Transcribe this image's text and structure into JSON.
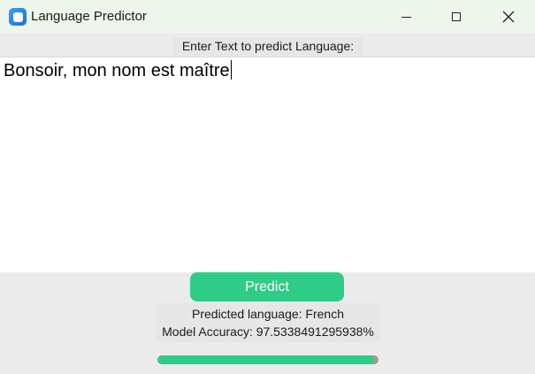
{
  "window": {
    "title": "Language Predictor",
    "icon": "app-icon",
    "controls": [
      "minimize-icon",
      "maximize-icon",
      "close-icon"
    ]
  },
  "input": {
    "label": "Enter Text to predict Language:",
    "value": "Bonsoir, mon nom est maître"
  },
  "actions": {
    "predict_label": "Predict"
  },
  "result": {
    "predicted_language": "Predicted language: French",
    "model_accuracy": "Model Accuracy: 97.5338491295938%"
  },
  "progress": {
    "fraction": 0.98
  },
  "colors": {
    "accent": "#2ecc87",
    "track": "#9a9a9a",
    "titlebar": "#eef5eb",
    "background": "#ebebeb"
  }
}
